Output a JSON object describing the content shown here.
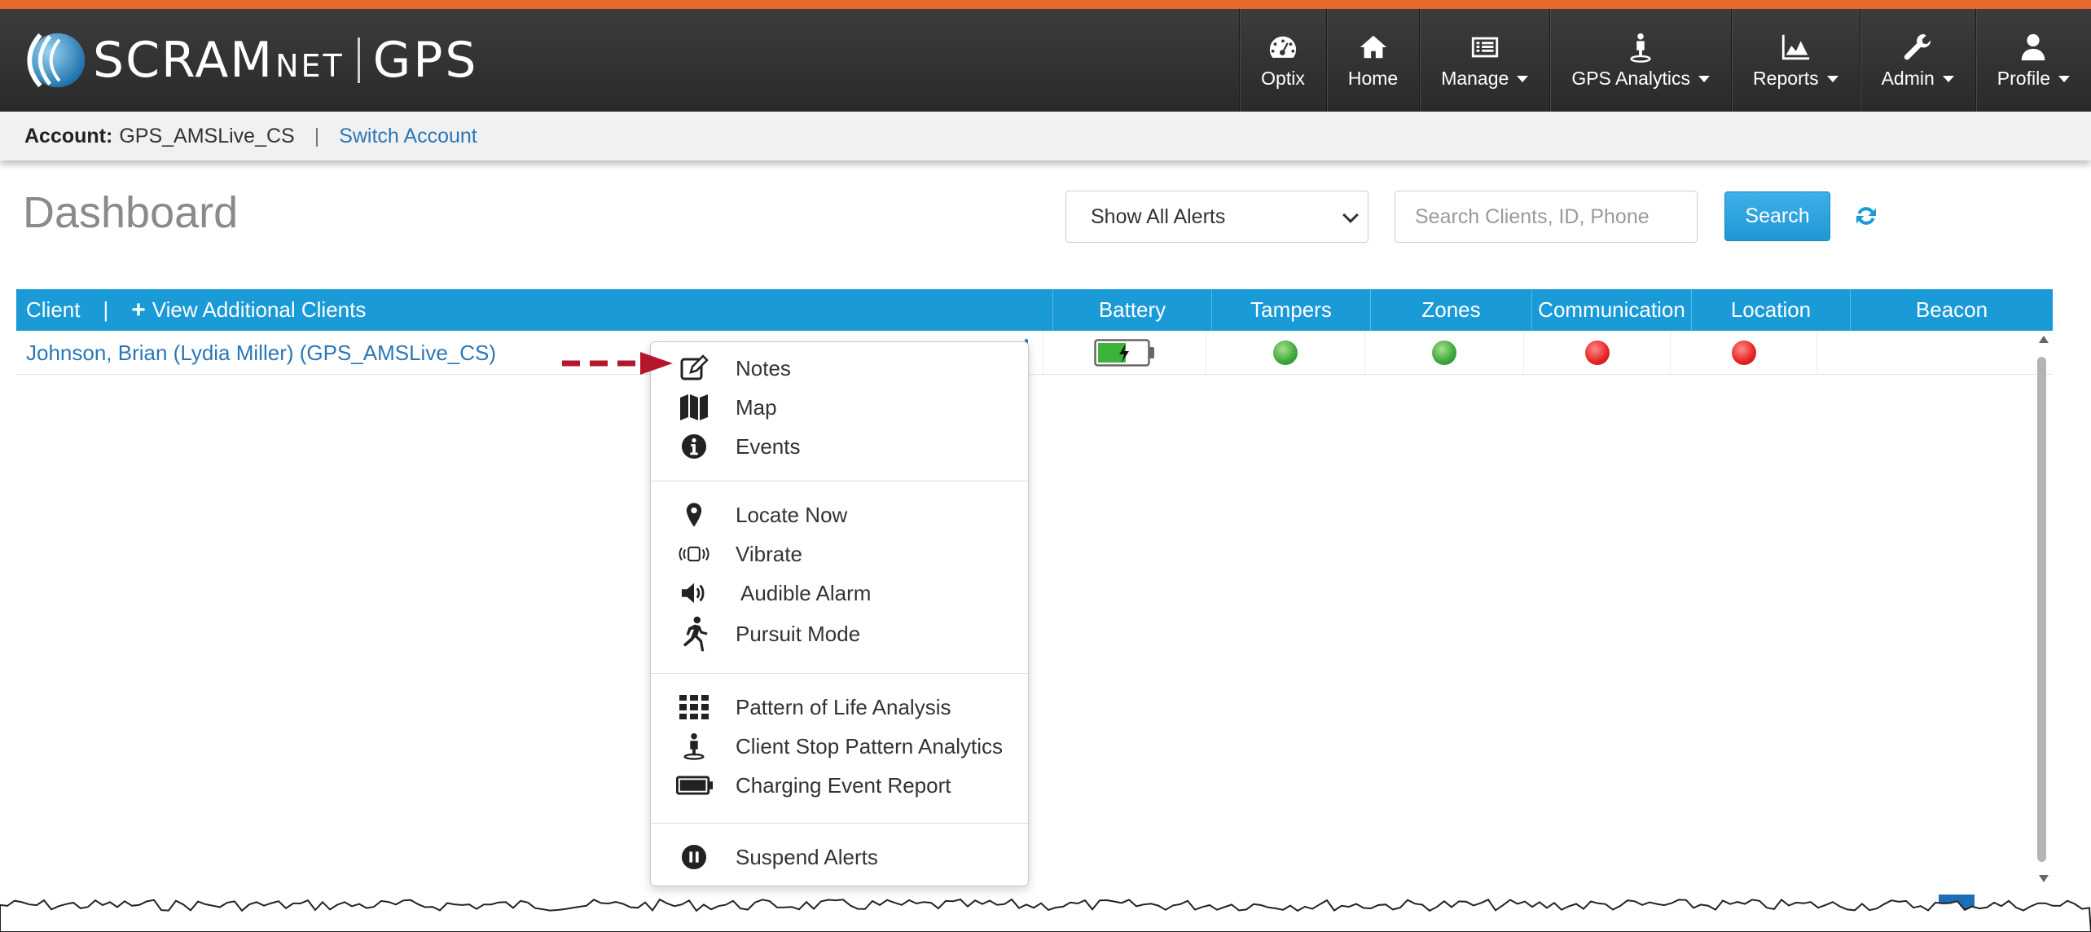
{
  "colors": {
    "accent_bar": "#e8672c",
    "navbar": "#2f2f2f",
    "table_header": "#1a9ad6",
    "link": "#2a77b8",
    "status_green": "#3aa63a",
    "status_red": "#e52222",
    "annotation_arrow": "#b5162c"
  },
  "brand": {
    "logo_scram": "SCRAM",
    "logo_net": "NET",
    "logo_gps": "GPS",
    "logo_icon": "swoosh-logo-icon"
  },
  "nav": {
    "items": [
      {
        "label": "Optix",
        "icon": "dashboard-gauge-icon",
        "has_caret": false
      },
      {
        "label": "Home",
        "icon": "home-icon",
        "has_caret": false
      },
      {
        "label": "Manage",
        "icon": "list-icon",
        "has_caret": true
      },
      {
        "label": "GPS Analytics",
        "icon": "person-pin-icon",
        "has_caret": true
      },
      {
        "label": "Reports",
        "icon": "area-chart-icon",
        "has_caret": true
      },
      {
        "label": "Admin",
        "icon": "wrench-icon",
        "has_caret": true
      },
      {
        "label": "Profile",
        "icon": "user-icon",
        "has_caret": true
      }
    ]
  },
  "account": {
    "label": "Account:",
    "name": "GPS_AMSLive_CS",
    "separator": "|",
    "switch_label": "Switch Account"
  },
  "dashboard": {
    "title": "Dashboard",
    "alert_filter": {
      "selected": "Show All Alerts",
      "icon": "chevron-down-icon"
    },
    "search": {
      "placeholder": "Search Clients, ID, Phone",
      "value": ""
    },
    "search_button": "Search",
    "refresh_icon": "refresh-icon"
  },
  "table": {
    "client_header": "Client",
    "header_separator": "|",
    "additional_clients": "View Additional Clients",
    "additional_icon": "plus-icon",
    "columns": [
      "Battery",
      "Tampers",
      "Zones",
      "Communication",
      "Location",
      "Beacon"
    ],
    "rows": [
      {
        "client": "Johnson, Brian (Lydia Miller) (GPS_AMSLive_CS)",
        "battery": {
          "icon": "battery-charging-icon",
          "level": 0.5
        },
        "tampers": "green",
        "zones": "green",
        "communication": "red",
        "location": "red",
        "beacon": ""
      }
    ]
  },
  "context_menu": {
    "groups": [
      [
        {
          "label": "Notes",
          "icon": "edit-note-icon"
        },
        {
          "label": "Map",
          "icon": "map-icon"
        },
        {
          "label": "Events",
          "icon": "info-circle-icon"
        }
      ],
      [
        {
          "label": "Locate Now",
          "icon": "map-pin-icon"
        },
        {
          "label": "Vibrate",
          "icon": "vibrate-icon"
        },
        {
          "label": "Audible Alarm",
          "icon": "speaker-icon"
        },
        {
          "label": "Pursuit Mode",
          "icon": "running-person-icon"
        }
      ],
      [
        {
          "label": "Pattern of Life Analysis",
          "icon": "grid-icon"
        },
        {
          "label": "Client Stop Pattern Analytics",
          "icon": "person-pin-icon"
        },
        {
          "label": "Charging Event Report",
          "icon": "battery-full-icon"
        }
      ],
      [
        {
          "label": "Suspend Alerts",
          "icon": "pause-circle-icon"
        }
      ]
    ],
    "pointer": "dashed-arrow-icon"
  }
}
